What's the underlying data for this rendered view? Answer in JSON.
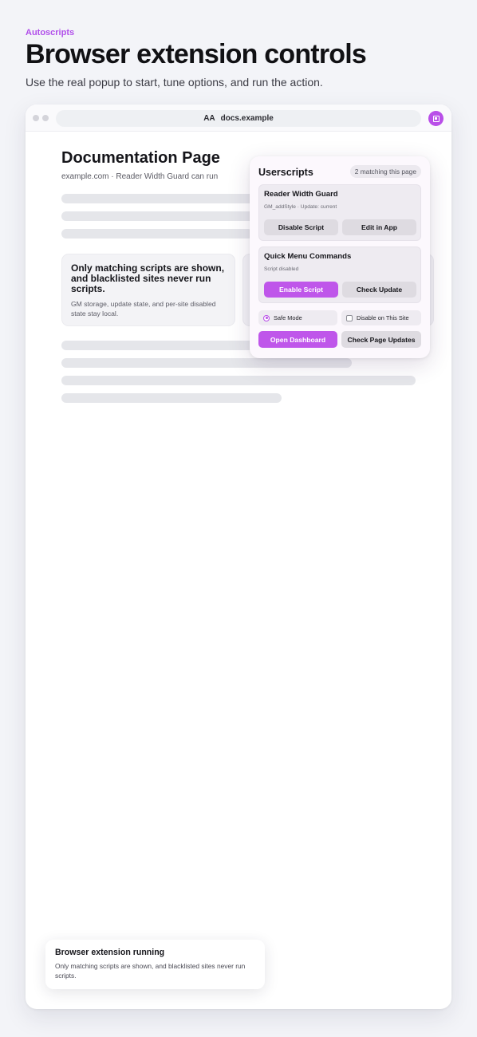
{
  "header": {
    "brand": "Autoscripts",
    "title": "Browser extension controls",
    "subtitle": "Use the real popup to start, tune options, and run the action."
  },
  "browser": {
    "address_prefix": "AA",
    "address": "docs.example",
    "extension_icon": "userscripts-extension-icon"
  },
  "page": {
    "title": "Documentation Page",
    "subtitle": "example.com · Reader Width Guard can run",
    "card": {
      "title": "Only matching scripts are shown, and blacklisted sites never run scripts.",
      "text": "GM storage, update state, and per-site disabled state stay local."
    }
  },
  "popup": {
    "title": "Userscripts",
    "count_badge": "2 matching this page",
    "scripts": [
      {
        "name": "Reader Width Guard",
        "meta": "GM_addStyle · Update: current",
        "primary_label": "Disable Script",
        "secondary_label": "Edit in App"
      },
      {
        "name": "Quick Menu Commands",
        "meta": "Script disabled",
        "primary_label": "Enable Script",
        "secondary_label": "Check Update"
      }
    ],
    "options": {
      "safe_mode": "Safe Mode",
      "disable_site": "Disable on This Site"
    },
    "actions": {
      "dashboard": "Open Dashboard",
      "check_updates": "Check Page Updates"
    },
    "accent_color": "#bf56ea"
  },
  "toast": {
    "title": "Browser extension running",
    "text": "Only matching scripts are shown, and blacklisted sites never run scripts."
  }
}
